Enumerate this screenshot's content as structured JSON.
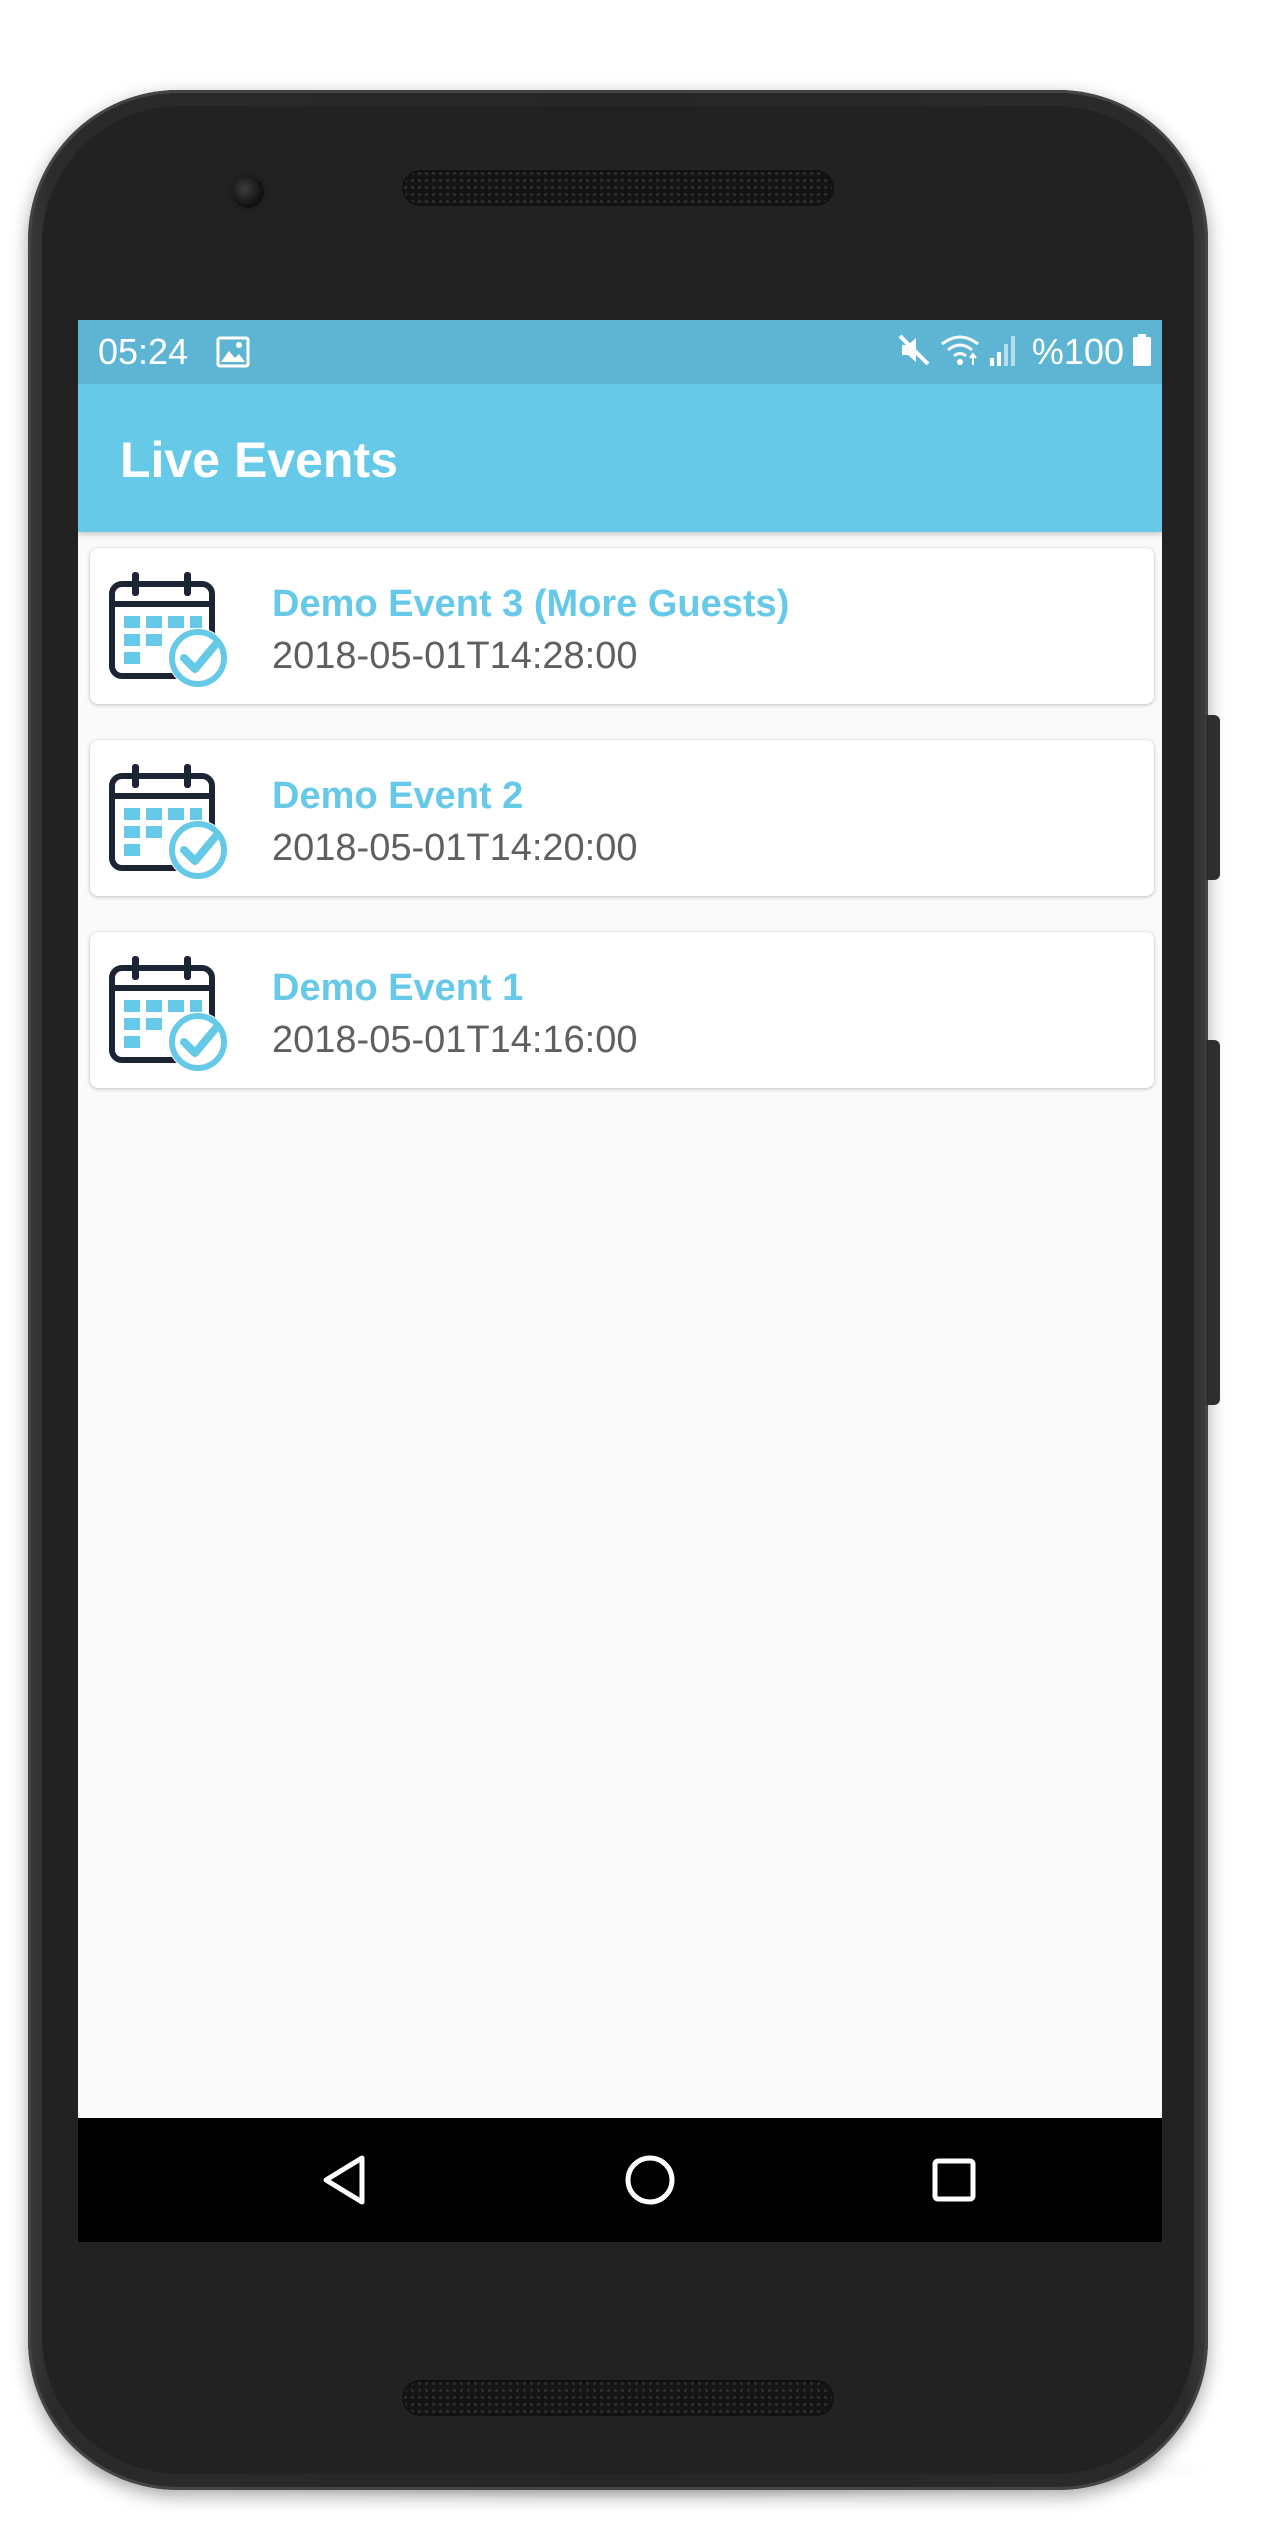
{
  "status_bar": {
    "time": "05:24",
    "battery": "%100",
    "icons": [
      "image-icon",
      "mute-icon",
      "wifi-icon",
      "signal-icon",
      "battery-icon"
    ]
  },
  "app_bar": {
    "title": "Live Events"
  },
  "events": [
    {
      "name": "Demo Event 3 (More Guests)",
      "date": "2018-05-01T14:28:00",
      "icon": "calendar-check-icon"
    },
    {
      "name": "Demo Event 2",
      "date": "2018-05-01T14:20:00",
      "icon": "calendar-check-icon"
    },
    {
      "name": "Demo Event 1",
      "date": "2018-05-01T14:16:00",
      "icon": "calendar-check-icon"
    }
  ],
  "nav_bar": {
    "buttons": [
      "back-icon",
      "home-icon",
      "recent-apps-icon"
    ]
  },
  "colors": {
    "status_bar": "#5db5d3",
    "app_bar": "#67c9e8",
    "accent": "#67c9e8",
    "icon_dark": "#1d2433",
    "list_background": "#fafafa",
    "nav_bar": "#000000"
  }
}
